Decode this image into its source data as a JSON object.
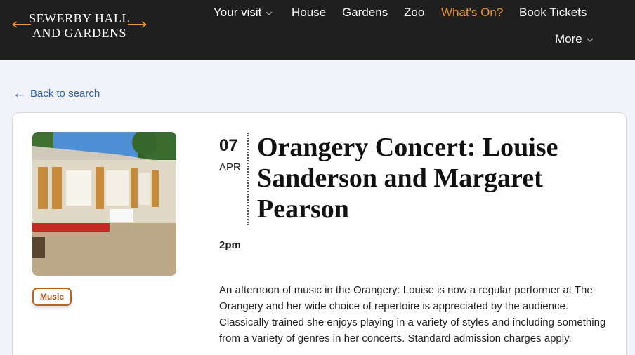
{
  "header": {
    "logo_line1": "SEWERBY HALL",
    "logo_line2": "AND GARDENS",
    "accent_color": "#e8953a",
    "nav": {
      "your_visit": "Your visit",
      "house": "House",
      "gardens": "Gardens",
      "zoo": "Zoo",
      "whats_on": "What's On?",
      "book_tickets": "Book Tickets",
      "more": "More"
    }
  },
  "back_link": "Back to search",
  "event": {
    "day": "07",
    "month": "APR",
    "title": "Orangery Concert: Louise Sanderson and Margaret Pearson",
    "time": "2pm",
    "category_tag": "Music",
    "description": "An afternoon of music in the Orangery: Louise is now a regular performer at The Orangery and her wide choice of repertoire is appreciated by the audience. Classically trained she enjoys playing in a variety of styles and including something from a variety of genres in her concerts. Standard admission charges apply."
  },
  "icons": [
    "chevron-down-icon",
    "arrow-left-icon"
  ]
}
